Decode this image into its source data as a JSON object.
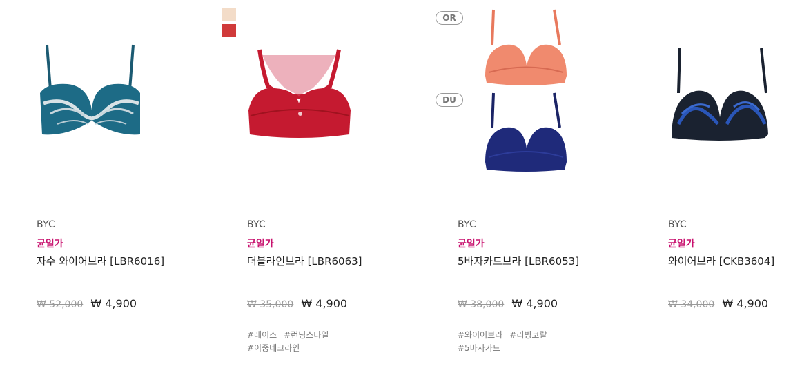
{
  "colors": {
    "promo": "#c8116e",
    "swatch_nude": "#f3dcc8",
    "swatch_red": "#d03a3a",
    "teal_bra": "#1d6b86",
    "red_bra": "#c51a30",
    "coral_bra": "#f08a6e",
    "navy_bra": "#1f2a7a",
    "black_blue_bra": "#1a2230"
  },
  "products": [
    {
      "brand": "BYC",
      "promo_label": "균일가",
      "name": "자수 와이어브라 [LBR6016]",
      "original_price": "₩ 52,000",
      "sale_price": "₩ 4,900",
      "image_icon": "teal-embroidered-bra",
      "tags": []
    },
    {
      "brand": "BYC",
      "promo_label": "균일가",
      "name": "더블라인브라 [LBR6063]",
      "original_price": "₩ 35,000",
      "sale_price": "₩ 4,900",
      "image_icon": "red-lace-bra",
      "tags": [
        "#레이스",
        "#런닝스타일",
        "#이중네크라인"
      ]
    },
    {
      "brand": "BYC",
      "promo_label": "균일가",
      "name": "5바자카드브라 [LBR6053]",
      "original_price": "₩ 38,000",
      "sale_price": "₩ 4,900",
      "image_icon": "coral-and-navy-bra",
      "color_badges": [
        "OR",
        "DU"
      ],
      "tags": [
        "#와이어브라",
        "#리빙코랄",
        "#5바자카드"
      ]
    },
    {
      "brand": "BYC",
      "promo_label": "균일가",
      "name": "와이어브라 [CKB3604]",
      "original_price": "₩ 34,000",
      "sale_price": "₩ 4,900",
      "image_icon": "black-blue-bra",
      "tags": []
    }
  ]
}
